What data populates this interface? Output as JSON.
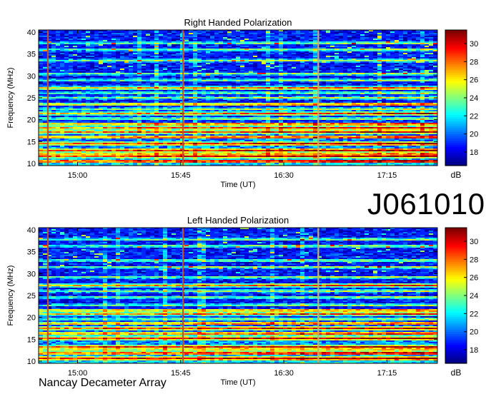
{
  "chart_data": [
    {
      "type": "heatmap",
      "title": "Right Handed Polarization",
      "xlabel": "Time (UT)",
      "ylabel": "Frequency (MHz)",
      "x_ticks": [
        "15:00",
        "15:45",
        "16:30",
        "17:15"
      ],
      "x_tick_minutes": [
        900,
        945,
        990,
        1035
      ],
      "xlim_minutes": [
        883,
        1057
      ],
      "y_ticks": [
        10,
        15,
        20,
        25,
        30,
        35,
        40
      ],
      "ylim": [
        9.5,
        40.5
      ],
      "colorbar": {
        "label": "dB",
        "ticks": [
          18,
          20,
          22,
          24,
          26,
          28,
          30
        ],
        "range": [
          16.5,
          31.5
        ]
      },
      "strong_bands_mhz": [
        10.5,
        11.7,
        13.0,
        14.5,
        16.0,
        17.2,
        18.1,
        19.0,
        21.4,
        23.5,
        27.2
      ],
      "moderate_bands_mhz": [
        12.3,
        20.2,
        22.4,
        25.0,
        26.1,
        29.0,
        30.5,
        33.5,
        36.0,
        37.5
      ],
      "vertical_lines_minutes": [
        887,
        946,
        1005
      ],
      "pattern_seed": 11
    },
    {
      "type": "heatmap",
      "title": "Left Handed Polarization",
      "xlabel": "Time (UT)",
      "ylabel": "Frequency (MHz)",
      "x_ticks": [
        "15:00",
        "15:45",
        "16:30",
        "17:15"
      ],
      "x_tick_minutes": [
        900,
        945,
        990,
        1035
      ],
      "xlim_minutes": [
        883,
        1057
      ],
      "y_ticks": [
        10,
        15,
        20,
        25,
        30,
        35,
        40
      ],
      "ylim": [
        9.5,
        40.5
      ],
      "colorbar": {
        "label": "dB",
        "ticks": [
          18,
          20,
          22,
          24,
          26,
          28,
          30
        ],
        "range": [
          16.5,
          31.5
        ]
      },
      "strong_bands_mhz": [
        10.6,
        11.8,
        13.2,
        15.2,
        16.3,
        17.5,
        18.6,
        20.8,
        21.6,
        27.3
      ],
      "moderate_bands_mhz": [
        12.5,
        19.6,
        22.8,
        24.6,
        26.0,
        29.2,
        31.5,
        33.0,
        36.3,
        37.8
      ],
      "vertical_lines_minutes": [
        887,
        946,
        1005
      ],
      "pattern_seed": 29
    }
  ],
  "observation_id": "J061010",
  "footer": "Nancay Decameter Array"
}
